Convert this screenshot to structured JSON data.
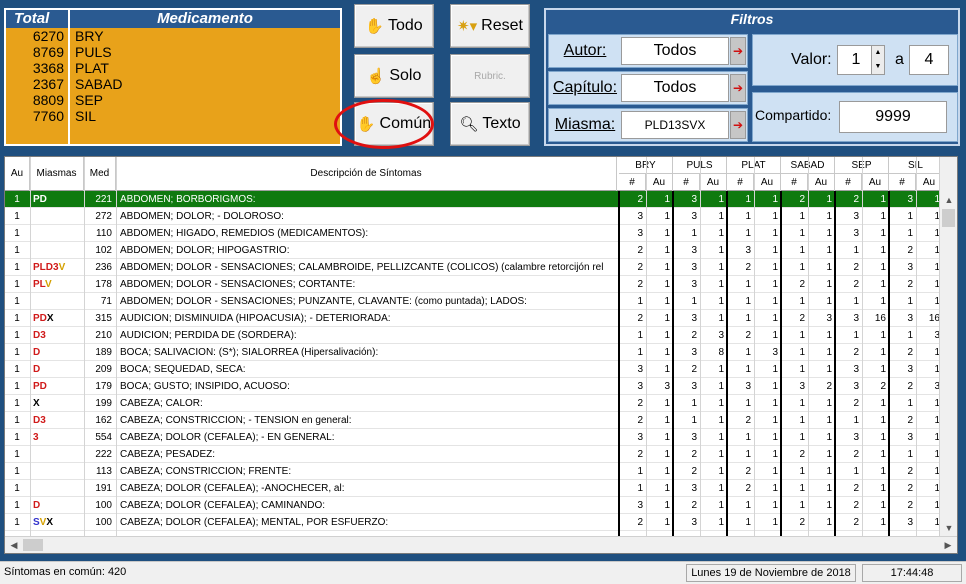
{
  "totals": {
    "header_total": "Total",
    "header_med": "Medicamento",
    "rows": [
      {
        "total": "6270",
        "med": "BRY"
      },
      {
        "total": "8769",
        "med": "PULS"
      },
      {
        "total": "3368",
        "med": "PLAT"
      },
      {
        "total": "2367",
        "med": "SABAD"
      },
      {
        "total": "8809",
        "med": "SEP"
      },
      {
        "total": "7760",
        "med": "SIL"
      }
    ]
  },
  "buttons": {
    "todo": "Todo",
    "solo": "Solo",
    "comun": "Común",
    "reset": "Reset",
    "rubric": "Rubric.",
    "texto": "Texto"
  },
  "filtros": {
    "title": "Filtros",
    "autor_label": "Autor:",
    "autor_value": "Todos",
    "capitulo_label": "Capítulo:",
    "capitulo_value": "Todos",
    "miasma_label": "Miasma:",
    "miasma_value": "PLD13SVX",
    "valor_label": "Valor:",
    "valor_from": "1",
    "valor_sep": "a",
    "valor_to": "4",
    "compartido_label": "Compartido:",
    "compartido_value": "9999"
  },
  "grid": {
    "headers": {
      "au": "Au",
      "miasmas": "Miasmas",
      "med": "Med",
      "desc": "Descripción de Síntomas",
      "sub_num": "#",
      "sub_au": "Au"
    },
    "remedies": [
      "BRY",
      "PULS",
      "PLAT",
      "SABAD",
      "SEP",
      "SIL"
    ],
    "rows": [
      {
        "au": "1",
        "mi": "PD",
        "med": "221",
        "desc": "ABDOMEN; BORBORIGMOS:",
        "v": [
          "2",
          "1",
          "3",
          "1",
          "1",
          "1",
          "2",
          "1",
          "2",
          "1",
          "3",
          "1"
        ]
      },
      {
        "au": "1",
        "mi": "",
        "med": "272",
        "desc": "ABDOMEN; DOLOR; - DOLOROSO:",
        "v": [
          "3",
          "1",
          "3",
          "1",
          "1",
          "1",
          "1",
          "1",
          "3",
          "1",
          "1",
          "1"
        ]
      },
      {
        "au": "1",
        "mi": "",
        "med": "110",
        "desc": "ABDOMEN; HIGADO, REMEDIOS (MEDICAMENTOS):",
        "v": [
          "3",
          "1",
          "1",
          "1",
          "1",
          "1",
          "1",
          "1",
          "3",
          "1",
          "1",
          "1"
        ]
      },
      {
        "au": "1",
        "mi": "",
        "med": "102",
        "desc": "ABDOMEN; DOLOR; HIPOGASTRIO:",
        "v": [
          "2",
          "1",
          "3",
          "1",
          "3",
          "1",
          "1",
          "1",
          "1",
          "1",
          "2",
          "1"
        ]
      },
      {
        "au": "1",
        "mi": "PLD3V",
        "med": "236",
        "desc": "ABDOMEN; DOLOR - SENSACIONES; CALAMBROIDE, PELLIZCANTE (COLICOS) (calambre retorcijón rel",
        "v": [
          "2",
          "1",
          "3",
          "1",
          "2",
          "1",
          "1",
          "1",
          "2",
          "1",
          "3",
          "1"
        ]
      },
      {
        "au": "1",
        "mi": "PLV",
        "med": "178",
        "desc": "ABDOMEN; DOLOR - SENSACIONES; CORTANTE:",
        "v": [
          "2",
          "1",
          "3",
          "1",
          "1",
          "1",
          "2",
          "1",
          "2",
          "1",
          "2",
          "1"
        ]
      },
      {
        "au": "1",
        "mi": "",
        "med": "71",
        "desc": "ABDOMEN; DOLOR - SENSACIONES; PUNZANTE, CLAVANTE: (como puntada); LADOS:",
        "v": [
          "1",
          "1",
          "1",
          "1",
          "1",
          "1",
          "1",
          "1",
          "1",
          "1",
          "1",
          "1"
        ]
      },
      {
        "au": "1",
        "mi": "PDX",
        "med": "315",
        "desc": "AUDICION; DISMINUIDA (HIPOACUSIA); - DETERIORADA:",
        "v": [
          "2",
          "1",
          "3",
          "1",
          "1",
          "1",
          "2",
          "3",
          "3",
          "16",
          "3",
          "16"
        ]
      },
      {
        "au": "1",
        "mi": "D3",
        "med": "210",
        "desc": "AUDICION; PERDIDA DE (SORDERA):",
        "v": [
          "1",
          "1",
          "2",
          "3",
          "2",
          "1",
          "1",
          "1",
          "1",
          "1",
          "1",
          "3"
        ]
      },
      {
        "au": "1",
        "mi": "D",
        "med": "189",
        "desc": "BOCA; SALIVACION:   (S*); SIALORREA (Hipersalivación):",
        "v": [
          "1",
          "1",
          "3",
          "8",
          "1",
          "3",
          "1",
          "1",
          "2",
          "1",
          "2",
          "1"
        ]
      },
      {
        "au": "1",
        "mi": "D",
        "med": "209",
        "desc": "BOCA; SEQUEDAD, SECA:",
        "v": [
          "3",
          "1",
          "2",
          "1",
          "1",
          "1",
          "1",
          "1",
          "3",
          "1",
          "3",
          "1"
        ]
      },
      {
        "au": "1",
        "mi": "PD",
        "med": "179",
        "desc": "BOCA; GUSTO; INSIPIDO, ACUOSO:",
        "v": [
          "3",
          "3",
          "3",
          "1",
          "3",
          "1",
          "3",
          "2",
          "3",
          "2",
          "2",
          "3"
        ]
      },
      {
        "au": "1",
        "mi": "X",
        "med": "199",
        "desc": "CABEZA; CALOR:",
        "v": [
          "2",
          "1",
          "1",
          "1",
          "1",
          "1",
          "1",
          "1",
          "2",
          "1",
          "1",
          "1"
        ]
      },
      {
        "au": "1",
        "mi": "D3",
        "med": "162",
        "desc": "CABEZA; CONSTRICCION; - TENSION en general:",
        "v": [
          "2",
          "1",
          "1",
          "1",
          "2",
          "1",
          "1",
          "1",
          "1",
          "1",
          "2",
          "1"
        ]
      },
      {
        "au": "1",
        "mi": "3",
        "med": "554",
        "desc": "CABEZA; DOLOR (CEFALEA); - EN GENERAL:",
        "v": [
          "3",
          "1",
          "3",
          "1",
          "1",
          "1",
          "1",
          "1",
          "3",
          "1",
          "3",
          "1"
        ]
      },
      {
        "au": "1",
        "mi": "",
        "med": "222",
        "desc": "CABEZA; PESADEZ:",
        "v": [
          "2",
          "1",
          "2",
          "1",
          "1",
          "1",
          "2",
          "1",
          "2",
          "1",
          "1",
          "1"
        ]
      },
      {
        "au": "1",
        "mi": "",
        "med": "113",
        "desc": "CABEZA; CONSTRICCION; FRENTE:",
        "v": [
          "1",
          "1",
          "2",
          "1",
          "2",
          "1",
          "1",
          "1",
          "1",
          "1",
          "2",
          "1"
        ]
      },
      {
        "au": "1",
        "mi": "",
        "med": "191",
        "desc": "CABEZA; DOLOR (CEFALEA); -ANOCHECER, al:",
        "v": [
          "1",
          "1",
          "3",
          "1",
          "2",
          "1",
          "1",
          "1",
          "2",
          "1",
          "2",
          "1"
        ]
      },
      {
        "au": "1",
        "mi": "D",
        "med": "100",
        "desc": "CABEZA; DOLOR (CEFALEA); CAMINANDO:",
        "v": [
          "3",
          "1",
          "2",
          "1",
          "1",
          "1",
          "1",
          "1",
          "2",
          "1",
          "2",
          "1"
        ]
      },
      {
        "au": "1",
        "mi": "SVX",
        "med": "100",
        "desc": "CABEZA; DOLOR (CEFALEA); MENTAL, POR ESFUERZO:",
        "v": [
          "2",
          "1",
          "3",
          "1",
          "1",
          "1",
          "2",
          "1",
          "2",
          "1",
          "3",
          "1"
        ]
      }
    ]
  },
  "status": {
    "sintomas": "Síntomas en común: 420",
    "fecha": "Lunes 19 de Noviembre de 2018",
    "hora": "17:44:48"
  },
  "icons": {
    "hand": "hand-icon",
    "sparkle": "sparkle-icon",
    "magnifier": "magnifier-icon"
  }
}
